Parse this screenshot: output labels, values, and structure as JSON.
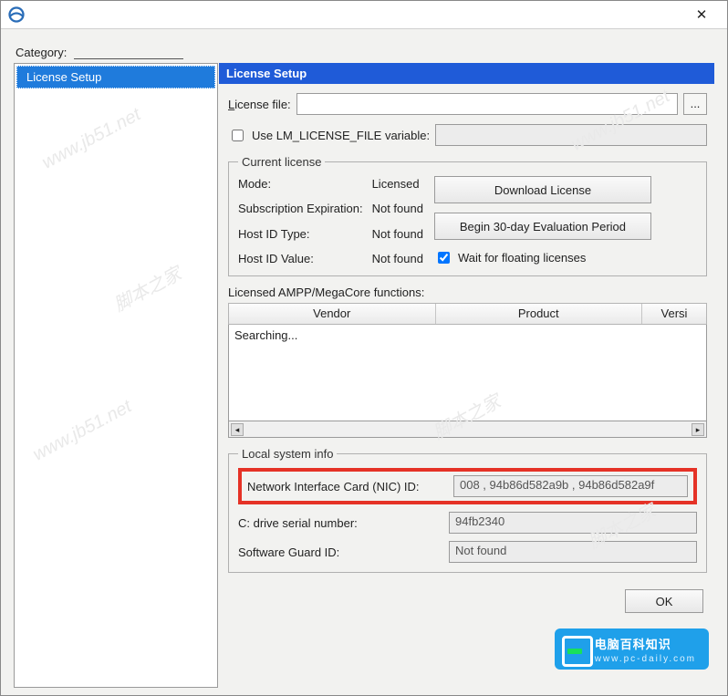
{
  "titlebar": {
    "close": "✕"
  },
  "category_label": "Category:",
  "tree": {
    "item": "License Setup"
  },
  "panel": {
    "title": "License Setup",
    "license_file_label": "License file:",
    "license_file_value": "",
    "browse": "...",
    "use_lm_label": "Use LM_LICENSE_FILE variable:",
    "use_lm_value": ""
  },
  "current": {
    "legend": "Current license",
    "mode_label": "Mode:",
    "mode_value": "Licensed",
    "sub_label": "Subscription Expiration:",
    "sub_value": "Not found",
    "hostidtype_label": "Host ID Type:",
    "hostidtype_value": "Not found",
    "hostidval_label": "Host ID Value:",
    "hostidval_value": "Not found",
    "download_btn": "Download License",
    "eval_btn": "Begin 30-day Evaluation Period",
    "wait_label": "Wait for floating licenses"
  },
  "functions": {
    "label": "Licensed AMPP/MegaCore functions:",
    "col_vendor": "Vendor",
    "col_product": "Product",
    "col_version": "Versi",
    "searching": "Searching...",
    "left_arrow": "◂",
    "right_arrow": "▸"
  },
  "local": {
    "legend": "Local system info",
    "nic_label": "Network Interface Card (NIC) ID:",
    "nic_value": "008 , 94b86d582a9b , 94b86d582a9f",
    "cdrive_label": "C: drive serial number:",
    "cdrive_value": "94fb2340",
    "sg_label": "Software Guard ID:",
    "sg_value": "Not found"
  },
  "dialog": {
    "ok": "OK"
  },
  "badge": {
    "title": "电脑百科知识",
    "url": "www.pc-daily.com"
  },
  "watermarks": [
    "www.jb51.net",
    "脚本之家",
    "www.jb51.net",
    "脚本之家",
    "www.jb51.net",
    "脚本之家"
  ]
}
